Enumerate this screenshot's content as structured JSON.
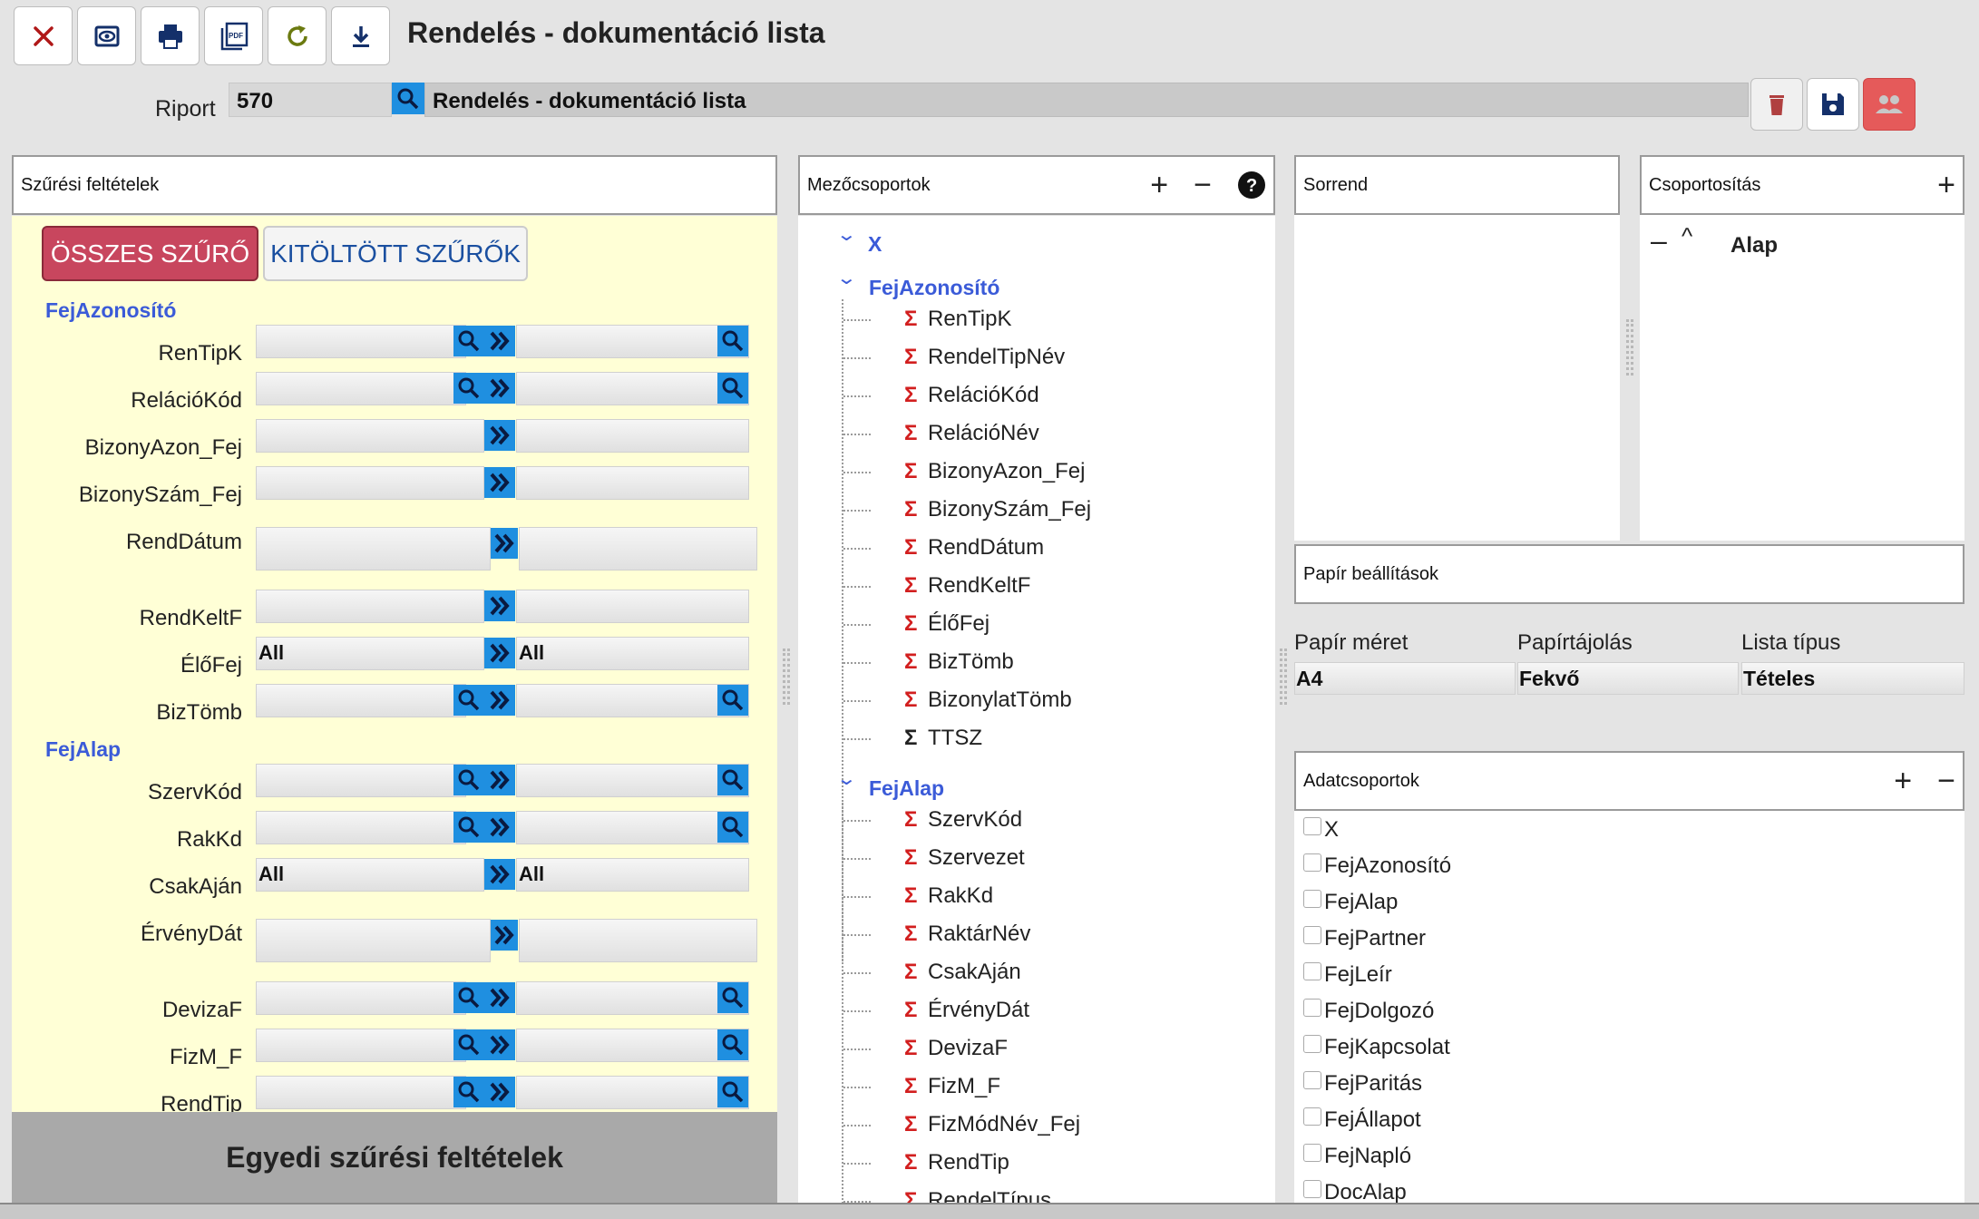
{
  "window": {
    "title": "Rendelés - dokumentáció lista"
  },
  "toolbar": {
    "buttons": [
      "close-icon",
      "eye-icon",
      "print-icon",
      "pdf-icon",
      "refresh-icon",
      "download-icon"
    ],
    "pdf_text": "PDF"
  },
  "riport": {
    "label": "Riport",
    "code": "570",
    "name": "Rendelés - dokumentáció lista"
  },
  "filters": {
    "header": "Szűrési feltételek",
    "btn_all": "ÖSSZES SZŰRŐ",
    "btn_filled": "KITÖLTÖTT SZŰRŐK",
    "group1": "FejAzonosító",
    "group2": "FejAlap",
    "rows": {
      "r1": {
        "label": "RenTipK"
      },
      "r2": {
        "label": "RelációKód"
      },
      "r3": {
        "label": "BizonyAzon_Fej"
      },
      "r4": {
        "label": "BizonySzám_Fej"
      },
      "r5": {
        "label": "RendDátum"
      },
      "r6": {
        "label": "RendKeltF"
      },
      "r7": {
        "label": "ÉlőFej",
        "left": "All",
        "right": "All"
      },
      "r8": {
        "label": "BizTömb"
      },
      "r9": {
        "label": "SzervKód"
      },
      "r10": {
        "label": "RakKd"
      },
      "r11": {
        "label": "CsakAján",
        "left": "All",
        "right": "All"
      },
      "r12": {
        "label": "ÉrvényDát"
      },
      "r13": {
        "label": "DevizaF"
      },
      "r14": {
        "label": "FizM_F"
      },
      "r15": {
        "label": "RendTip"
      }
    },
    "custom": "Egyedi szűrési feltételek"
  },
  "fields": {
    "header": "Mezőcsoportok",
    "group_x": "X",
    "group1": "FejAzonosító",
    "group1_items": [
      "RenTipK",
      "RendelTipNév",
      "RelációKód",
      "RelációNév",
      "BizonyAzon_Fej",
      "BizonySzám_Fej",
      "RendDátum",
      "RendKeltF",
      "ÉlőFej",
      "BizTömb",
      "BizonylatTömb",
      "TTSZ"
    ],
    "group2": "FejAlap",
    "group2_items": [
      "SzervKód",
      "Szervezet",
      "RakKd",
      "RaktárNév",
      "CsakAján",
      "ÉrvényDát",
      "DevizaF",
      "FizM_F",
      "FizMódNév_Fej",
      "RendTip",
      "RendelTípus"
    ]
  },
  "sort": {
    "header": "Sorrend"
  },
  "grouping": {
    "header": "Csoportosítás",
    "item": "Alap"
  },
  "paper": {
    "header": "Papír beállítások",
    "col1": "Papír méret",
    "col2": "Papírtájolás",
    "col3": "Lista típus",
    "val1": "A4",
    "val2": "Fekvő",
    "val3": "Tételes"
  },
  "datagroups": {
    "header": "Adatcsoportok",
    "items": [
      "X",
      "FejAzonosító",
      "FejAlap",
      "FejPartner",
      "FejLeír",
      "FejDolgozó",
      "FejKapcsolat",
      "FejParitás",
      "FejÁllapot",
      "FejNapló",
      "DocAlap"
    ]
  },
  "colors": {
    "accent_blue": "#1f8fe0",
    "group_blue": "#3b5bd8",
    "danger": "#c8465e",
    "filter_bg": "#ffffd6"
  }
}
